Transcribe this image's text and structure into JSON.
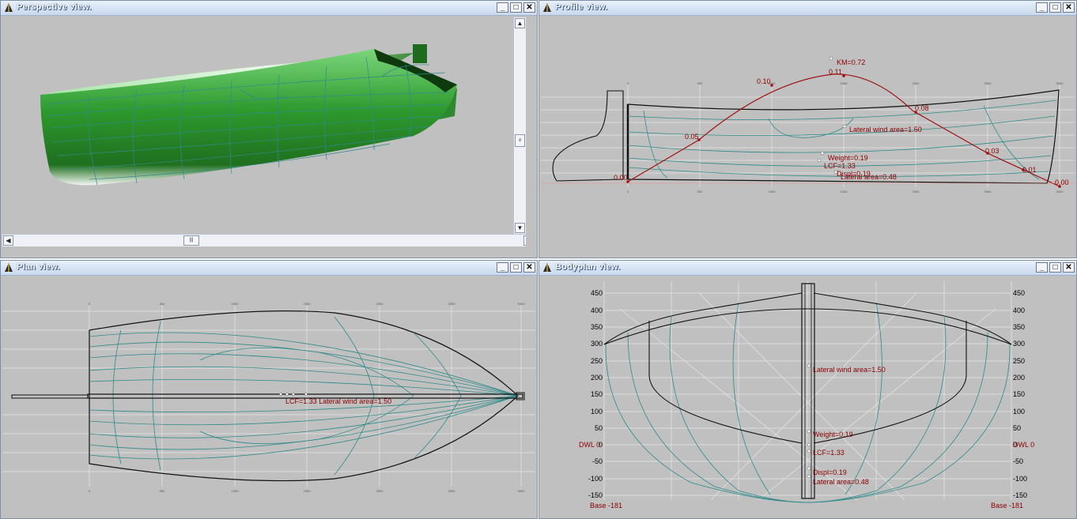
{
  "windows": {
    "perspective": {
      "title": "Perspective view."
    },
    "profile": {
      "title": "Profile view."
    },
    "plan": {
      "title": "Plan view."
    },
    "bodyplan": {
      "title": "Bodyplan view."
    }
  },
  "controls": {
    "minimize": "_",
    "maximize": "□",
    "close": "✕"
  },
  "scroll": {
    "up": "▲",
    "down": "▼",
    "left": "◀",
    "right": "▶",
    "grip": "|||"
  },
  "profile": {
    "labels": {
      "km": "KM=0.72",
      "c011": "0.11",
      "c010": "0.10",
      "c008": "0.08",
      "c005": "0.05",
      "c003": "0.03",
      "c001": "0.01",
      "c000l": "0.00",
      "c000r": "0.00",
      "wind": "Lateral wind area=1.50",
      "weight": "Weight=0.19",
      "lcf": "LCF=1.33",
      "displ": "Displ=0.19",
      "lat": "Lateral area=0.48"
    },
    "ticks": [
      "0",
      "500",
      "1000",
      "1500",
      "2000",
      "2500",
      "3000"
    ]
  },
  "plan": {
    "label": "LCF=1.33 Lateral wind area=1.50",
    "ticks": [
      "0",
      "500",
      "1000",
      "1500",
      "2000",
      "2500",
      "3000"
    ]
  },
  "bodyplan": {
    "left_axis": [
      "450",
      "400",
      "350",
      "300",
      "250",
      "200",
      "150",
      "100",
      "50",
      "0",
      "-50",
      "-100",
      "-150"
    ],
    "right_axis": [
      "450",
      "400",
      "350",
      "300",
      "250",
      "200",
      "150",
      "100",
      "50",
      "0",
      "-50",
      "-100",
      "-150"
    ],
    "dwl_left": "DWL 0",
    "dwl_right": "DWL 0",
    "base_left": "Base -181",
    "base_right": "Base -181",
    "labels": {
      "wind": "Lateral wind area=1.50",
      "weight": "Weight=0.19",
      "lcf": "LCF=1.33",
      "displ": "Displ=0.19",
      "lat": "Lateral area=0.48"
    }
  },
  "colors": {
    "hull_green": "#2e9a2e",
    "mesh": "#2f8a8a",
    "curve": "#a01010",
    "label": "#8b0000",
    "background": "#c0c0c0"
  }
}
